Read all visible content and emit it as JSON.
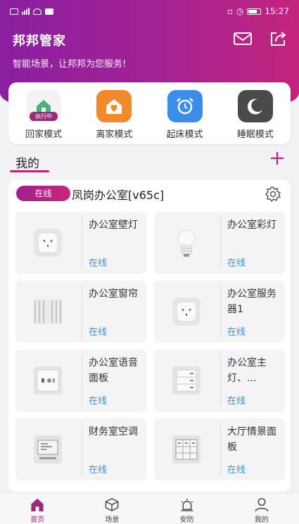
{
  "status_bar": {
    "time": "15:27"
  },
  "header": {
    "title": "邦邦管家",
    "subtitle": "智能场景，让邦邦为您服务!",
    "mail_icon": "mail-icon",
    "share_icon": "share-icon"
  },
  "modes": [
    {
      "label": "回家模式",
      "icon": "home-icon",
      "color": "#4caf7d",
      "badge": "执行中"
    },
    {
      "label": "离家模式",
      "icon": "house-heart-icon",
      "color": "#f08a2c"
    },
    {
      "label": "起床模式",
      "icon": "alarm-clock-icon",
      "color": "#3b8ee8"
    },
    {
      "label": "睡眠模式",
      "icon": "moon-icon",
      "color": "#4a4a4a"
    }
  ],
  "mine": {
    "title": "我的",
    "add_icon": "plus-icon"
  },
  "room": {
    "status": "在线",
    "name": "凤岗办公室[v65c]",
    "settings_icon": "gear-icon"
  },
  "devices": [
    {
      "name": "办公室壁灯",
      "status": "在线",
      "icon": "wall-socket-icon"
    },
    {
      "name": "办公室彩灯",
      "status": "在线",
      "icon": "bulb-icon"
    },
    {
      "name": "办公室窗帘",
      "status": "在线",
      "icon": "curtain-icon"
    },
    {
      "name": "办公室服务器1",
      "status": "在线",
      "icon": "wall-socket-icon"
    },
    {
      "name": "办公室语音面板",
      "status": "在线",
      "icon": "voice-panel-icon"
    },
    {
      "name": "办公室主灯、...",
      "status": "在线",
      "icon": "switch-panel-icon"
    },
    {
      "name": "财务室空调",
      "status": "在线",
      "icon": "ac-panel-icon"
    },
    {
      "name": "大厅情景面板",
      "status": "在线",
      "icon": "scene-panel-icon"
    }
  ],
  "tabs": [
    {
      "label": "首页",
      "icon": "home-tab-icon"
    },
    {
      "label": "场景",
      "icon": "cube-icon"
    },
    {
      "label": "安防",
      "icon": "alarm-light-icon"
    },
    {
      "label": "我的",
      "icon": "person-icon"
    }
  ]
}
